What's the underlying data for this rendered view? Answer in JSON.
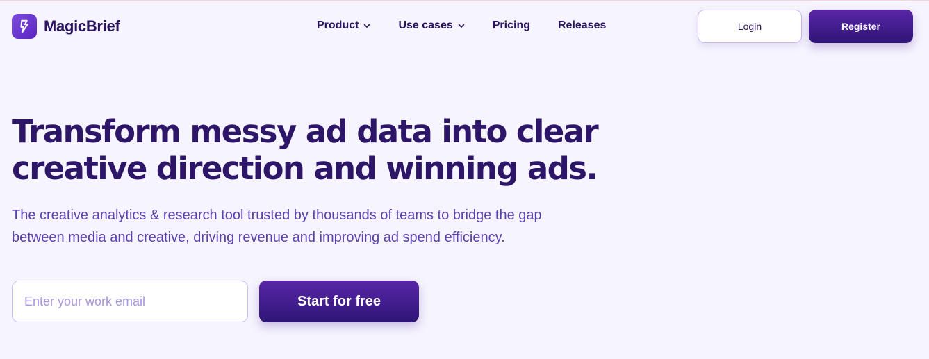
{
  "brand": {
    "name": "MagicBrief",
    "logo_icon": "lightning-bolt-icon",
    "accent": "#5a26a8"
  },
  "nav": {
    "items": [
      {
        "label": "Product",
        "dropdown": true
      },
      {
        "label": "Use cases",
        "dropdown": true
      },
      {
        "label": "Pricing",
        "dropdown": false
      },
      {
        "label": "Releases",
        "dropdown": false
      }
    ]
  },
  "auth": {
    "login_label": "Login",
    "register_label": "Register"
  },
  "hero": {
    "title": "Transform messy ad data into clear creative direction and winning ads.",
    "subtitle": "The creative analytics & research tool trusted by thousands of teams to bridge the gap between media and creative, driving revenue and improving ad spend efficiency.",
    "email_placeholder": "Enter your work email",
    "email_value": "",
    "cta_label": "Start for free"
  }
}
